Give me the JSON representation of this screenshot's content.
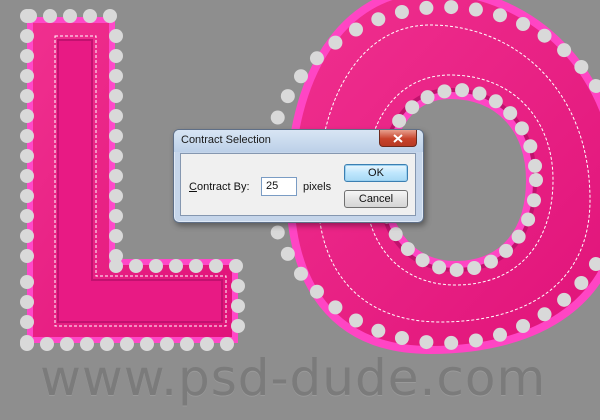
{
  "dialog": {
    "title": "Contract Selection",
    "contract_by_prefix": "C",
    "contract_by_rest": "ontract By:",
    "value": "25",
    "unit": "pixels",
    "ok_label": "OK",
    "cancel_label": "Cancel"
  },
  "watermark": "www.psd-dude.com",
  "colors": {
    "canvas_background": "#8e8e8e",
    "letter_pink": "#ee1f8a",
    "letter_edge": "#ff3fc0",
    "letter_highlight": "#f54aa8",
    "dot": "#d9d9d9",
    "dialog_frame": "#c5d5ea",
    "close_button": "#c7432b"
  },
  "icons": {
    "close": "close-icon",
    "selection": "marching-ants-selection"
  }
}
